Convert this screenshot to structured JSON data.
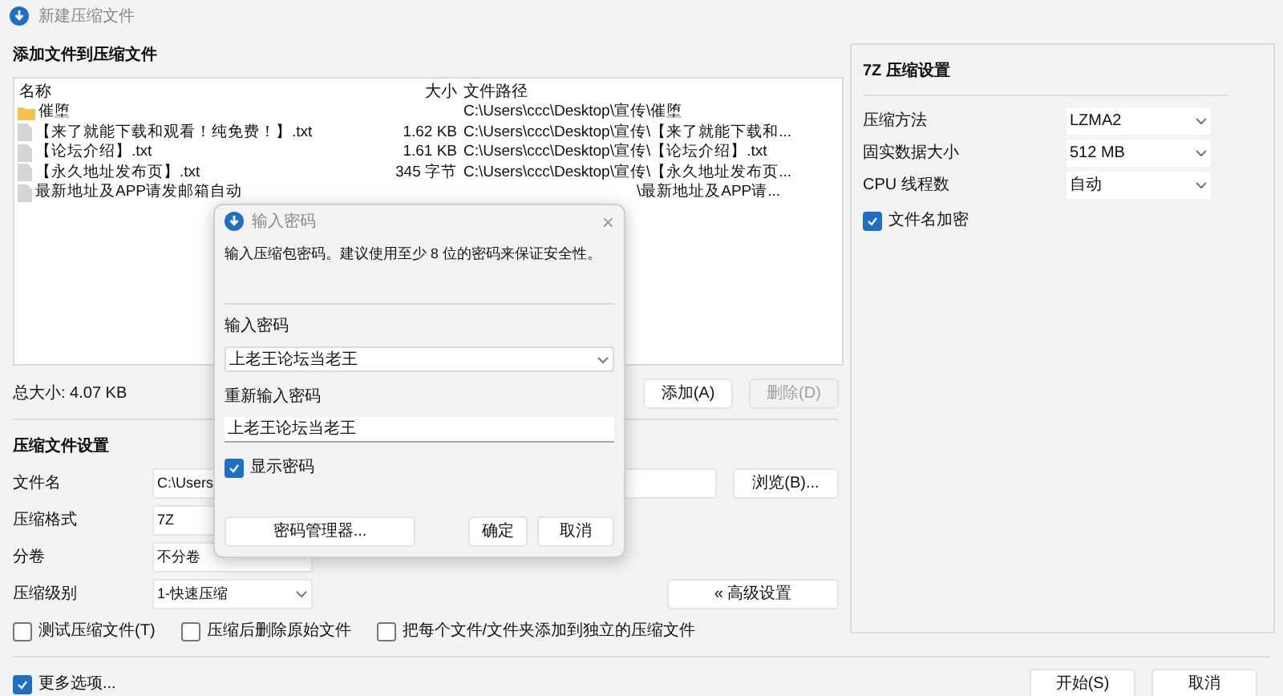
{
  "window": {
    "title": "新建压缩文件"
  },
  "files_section": {
    "heading": "添加文件到压缩文件",
    "columns": [
      "名称",
      "大小",
      "文件路径"
    ],
    "rows": [
      {
        "kind": "folder",
        "name": "催堕",
        "path": "C:\\Users\\ccc\\Desktop\\宣传\\催堕"
      },
      {
        "kind": "file",
        "name": "【来了就能下载和观看！纯免费！】.txt",
        "size": "1.62 KB",
        "path": "C:\\Users\\ccc\\Desktop\\宣传\\【来了就能下载和..."
      },
      {
        "kind": "file",
        "name": "【论坛介绍】.txt",
        "size": "1.61 KB",
        "path": "C:\\Users\\ccc\\Desktop\\宣传\\【论坛介绍】.txt"
      },
      {
        "kind": "file",
        "name": "【永久地址发布页】.txt",
        "size": "345 字节",
        "path": "C:\\Users\\ccc\\Desktop\\宣传\\【永久地址发布页..."
      },
      {
        "kind": "file",
        "name": "最新地址及APP请发邮箱自动",
        "path": "\\最新地址及APP请..."
      }
    ],
    "total": "总大小: 4.07 KB",
    "buttons": [
      {
        "label": "添加(A)",
        "disabled": false
      },
      {
        "label": "删除(D)",
        "disabled": true
      }
    ]
  },
  "archive_settings": {
    "heading": "压缩文件设置",
    "fields": [
      {
        "label": "文件名",
        "kind": "field",
        "value": "C:\\Users"
      },
      {
        "label": "压缩格式",
        "kind": "field",
        "value": "7Z"
      },
      {
        "label": "分卷",
        "kind": "field",
        "value": "不分卷"
      },
      {
        "label": "压缩级别",
        "kind": "select",
        "value": "1-快速压缩"
      }
    ],
    "browse_button": "浏览(B)...",
    "advanced_button": "« 高级设置",
    "options": [
      {
        "label": "测试压缩文件(T)",
        "checked": false
      },
      {
        "label": "压缩后删除原始文件",
        "checked": false
      },
      {
        "label": "把每个文件/文件夹添加到独立的压缩文件",
        "checked": false
      }
    ]
  },
  "seven_zip": {
    "heading": "7Z 压缩设置",
    "fields": [
      {
        "label": "压缩方法",
        "value": "LZMA2"
      },
      {
        "label": "固实数据大小",
        "value": "512 MB"
      },
      {
        "label": "CPU 线程数",
        "value": "自动"
      }
    ],
    "encrypt_names": {
      "label": "文件名加密",
      "checked": true
    }
  },
  "footer": {
    "more_options": {
      "label": "更多选项...",
      "checked": true
    },
    "buttons": [
      "开始(S)",
      "取消"
    ]
  },
  "password_dialog": {
    "title": "输入密码",
    "close": "×",
    "message": "输入压缩包密码。建议使用至少 8 位的密码来保证安全性。",
    "password_label": "输入密码",
    "password": "上老王论坛当老王",
    "confirm_label": "重新输入密码",
    "confirm": "上老王论坛当老王",
    "show_password": {
      "label": "显示密码",
      "checked": true
    },
    "buttons": [
      "密码管理器...",
      "确定",
      "取消"
    ]
  }
}
